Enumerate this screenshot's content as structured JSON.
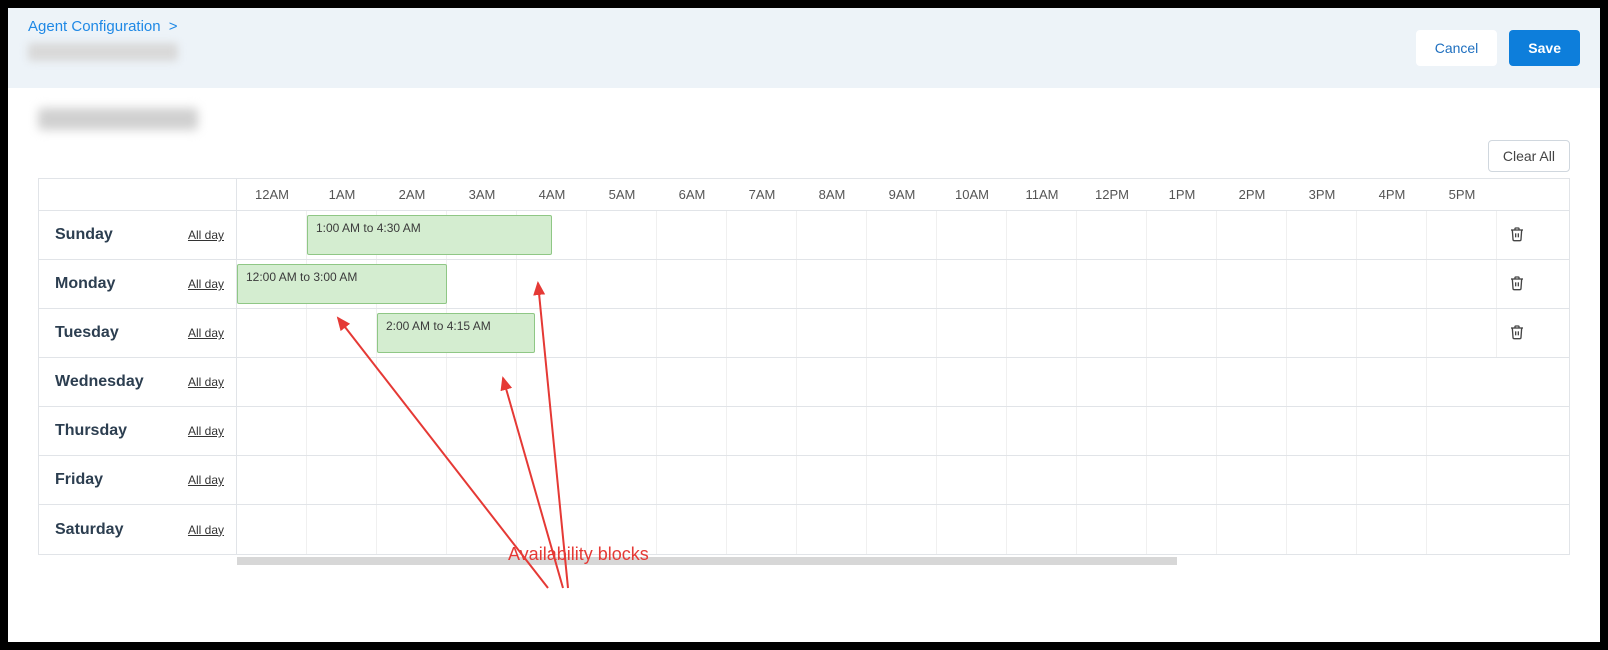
{
  "breadcrumb": {
    "label": "Agent Configuration",
    "chevron": ">"
  },
  "buttons": {
    "cancel": "Cancel",
    "save": "Save",
    "clear_all": "Clear All"
  },
  "hours": [
    "12AM",
    "1AM",
    "2AM",
    "3AM",
    "4AM",
    "5AM",
    "6AM",
    "7AM",
    "8AM",
    "9AM",
    "10AM",
    "11AM",
    "12PM",
    "1PM",
    "2PM",
    "3PM",
    "4PM",
    "5PM"
  ],
  "allday_label": "All day",
  "days": [
    {
      "name": "Sunday",
      "has_trash": true,
      "blocks": [
        {
          "label": "1:00 AM to 4:30 AM",
          "start_hour": 1.0,
          "end_hour": 4.5
        }
      ]
    },
    {
      "name": "Monday",
      "has_trash": true,
      "blocks": [
        {
          "label": "12:00 AM to 3:00 AM",
          "start_hour": 0.0,
          "end_hour": 3.0
        }
      ]
    },
    {
      "name": "Tuesday",
      "has_trash": true,
      "blocks": [
        {
          "label": "2:00 AM to 4:15 AM",
          "start_hour": 2.0,
          "end_hour": 4.25
        }
      ]
    },
    {
      "name": "Wednesday",
      "has_trash": false,
      "blocks": []
    },
    {
      "name": "Thursday",
      "has_trash": false,
      "blocks": []
    },
    {
      "name": "Friday",
      "has_trash": false,
      "blocks": []
    },
    {
      "name": "Saturday",
      "has_trash": false,
      "blocks": []
    }
  ],
  "annotation": {
    "label": "Availability blocks"
  },
  "colors": {
    "block_bg": "#d4edd0",
    "block_border": "#8fc785",
    "accent": "#0d7edb",
    "annotation": "#e53935"
  }
}
